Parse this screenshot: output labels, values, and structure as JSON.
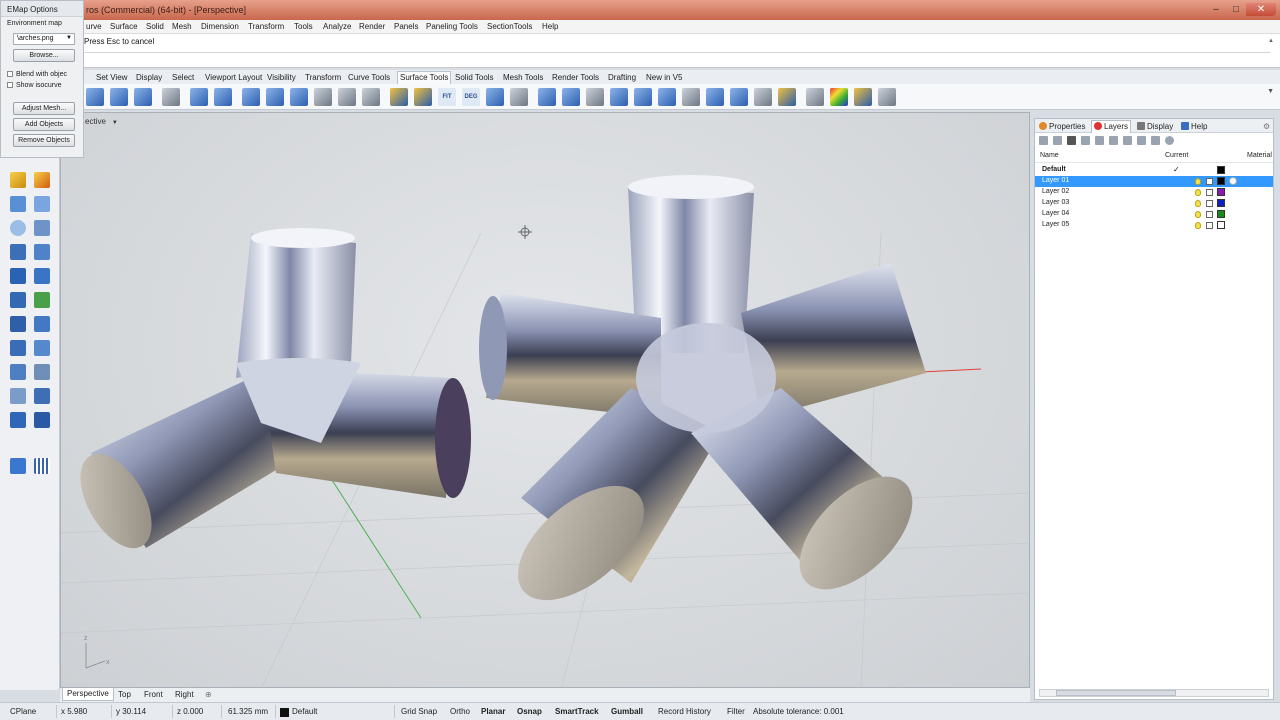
{
  "window": {
    "title": "ros (Commercial) (64-bit) - [Perspective]",
    "controls": [
      "–",
      "□",
      "✕"
    ]
  },
  "menu": [
    "urve",
    "Surface",
    "Solid",
    "Mesh",
    "Dimension",
    "Transform",
    "Tools",
    "Analyze",
    "Render",
    "Panels",
    "Paneling Tools",
    "SectionTools",
    "Help"
  ],
  "command": {
    "prompt": "Press Esc to cancel"
  },
  "toolbar_tabs": {
    "items": [
      "Set View",
      "Display",
      "Select",
      "Viewport Layout",
      "Visibility",
      "Transform",
      "Curve Tools",
      "Surface Tools",
      "Solid Tools",
      "Mesh Tools",
      "Render Tools",
      "Drafting",
      "New in V5"
    ],
    "active": "Surface Tools"
  },
  "toolbar_icons": [
    "fit",
    "deg"
  ],
  "toolbar_icon_text": {
    "fit": "FIT",
    "deg": "DEG"
  },
  "emap": {
    "title": "EMap Options",
    "env_label": "Environment map",
    "file_value": "\\arches.png",
    "browse": "Browse...",
    "blend": "Blend with objec",
    "isocurve": "Show isocurve",
    "adjust_mesh": "Adjust Mesh...",
    "add_objects": "Add Objects",
    "remove_objects": "Remove Objects"
  },
  "viewport": {
    "title": "ective",
    "axis_labels": {
      "z": "z",
      "x": "x"
    }
  },
  "right_panel": {
    "tabs": [
      "Properties",
      "Layers",
      "Display",
      "Help"
    ],
    "active_tab": "Layers",
    "columns": {
      "name": "Name",
      "current": "Current",
      "material": "Material"
    },
    "layers": [
      {
        "name": "Default",
        "current": "✓",
        "color": "#000000",
        "bold": true
      },
      {
        "name": "Layer 01",
        "current": "",
        "color": "#000000",
        "selected": true
      },
      {
        "name": "Layer 02",
        "current": "",
        "color": "#8a1bb0"
      },
      {
        "name": "Layer 03",
        "current": "",
        "color": "#1020c0"
      },
      {
        "name": "Layer 04",
        "current": "",
        "color": "#1a8a1a"
      },
      {
        "name": "Layer 05",
        "current": "",
        "color": "#ffffff"
      }
    ]
  },
  "viewport_tabs": {
    "items": [
      "Perspective",
      "Top",
      "Front",
      "Right",
      "⊕"
    ],
    "active": "Perspective"
  },
  "status": {
    "cplane": "CPlane",
    "x": "x 5.980",
    "y": "y 30.114",
    "z": "z 0.000",
    "distance": "61.325 mm",
    "layer": "Default",
    "grid_snap": "Grid Snap",
    "ortho": "Ortho",
    "planar": "Planar",
    "osnap": "Osnap",
    "smarttrack": "SmartTrack",
    "gumball": "Gumball",
    "record_history": "Record History",
    "filter": "Filter",
    "tolerance": "Absolute tolerance: 0.001"
  },
  "colors": {
    "accent": "#3399ff",
    "titlebar": "#d47a62",
    "viewport_bg": "#d6d9dc"
  }
}
